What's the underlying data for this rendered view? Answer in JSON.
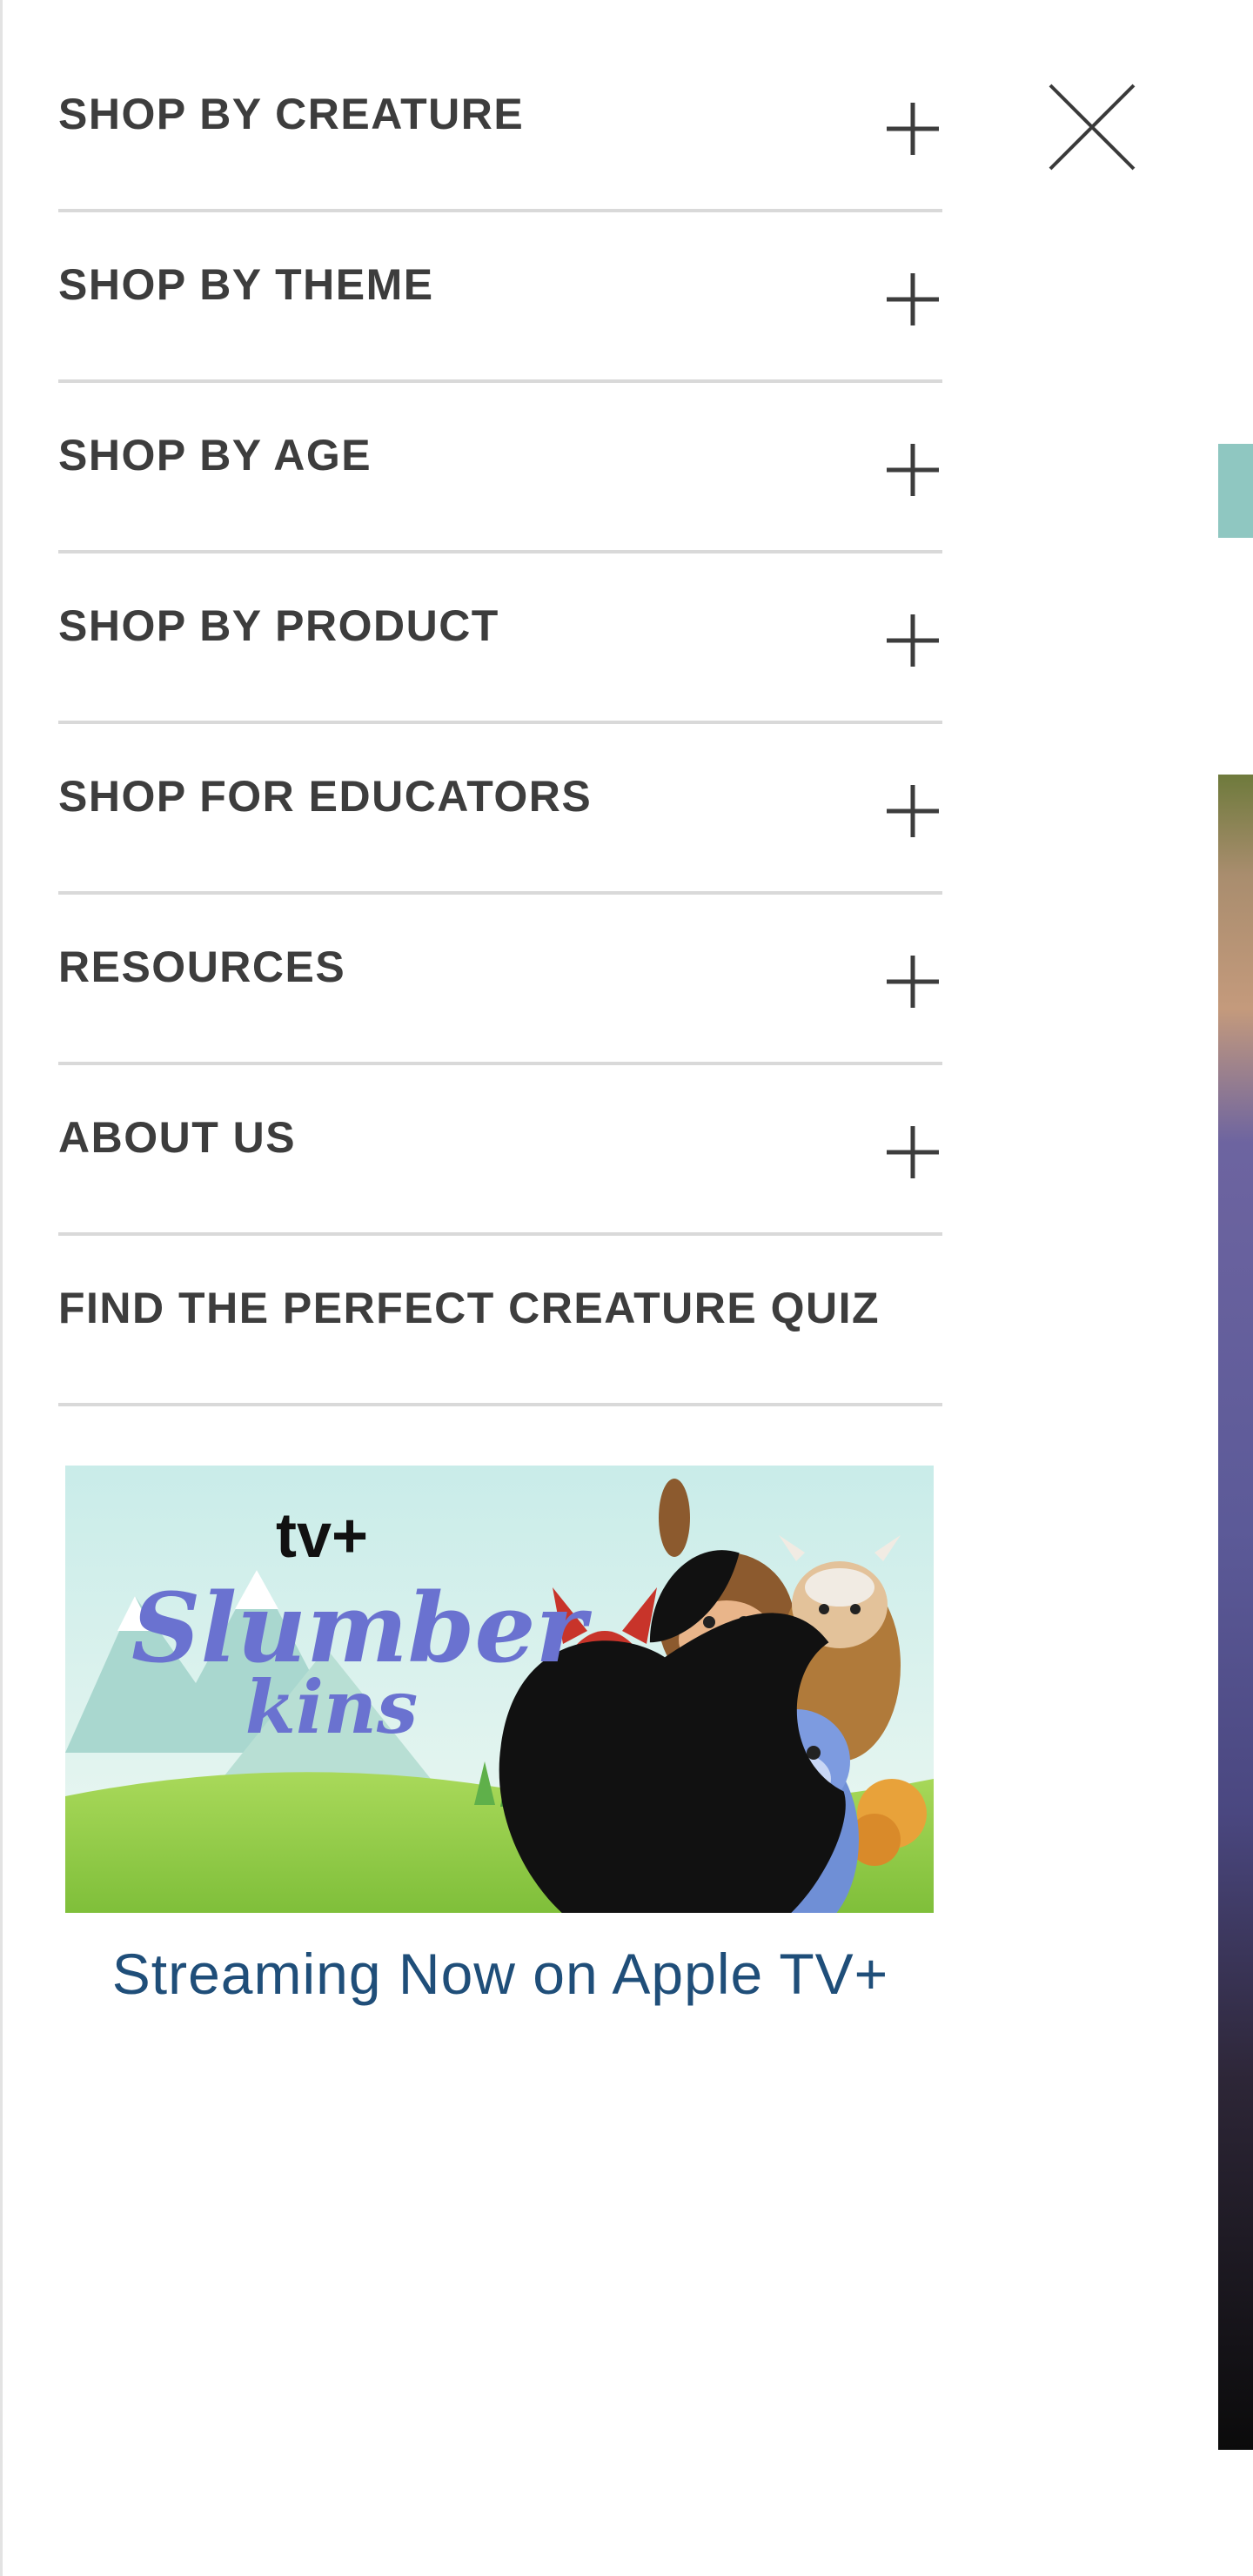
{
  "menu": {
    "items": [
      {
        "label": "SHOP BY CREATURE",
        "icon": "plus-icon"
      },
      {
        "label": "SHOP BY THEME",
        "icon": "plus-icon"
      },
      {
        "label": "SHOP BY AGE",
        "icon": "plus-icon"
      },
      {
        "label": "SHOP BY PRODUCT",
        "icon": "plus-icon"
      },
      {
        "label": "SHOP FOR EDUCATORS",
        "icon": "plus-icon"
      },
      {
        "label": "RESOURCES",
        "icon": "plus-icon"
      },
      {
        "label": "ABOUT US",
        "icon": "plus-icon"
      },
      {
        "label": "FIND THE PERFECT CREATURE QUIZ"
      }
    ],
    "close_icon": "close-icon"
  },
  "promo": {
    "platform": "tv+",
    "title_line1": "Slumber",
    "title_line2": "kins",
    "caption": "Streaming Now on Apple TV+"
  },
  "colors": {
    "menu_text": "#3d3d3d",
    "divider": "#d9d9d9",
    "caption_link": "#1f4e79",
    "title_lettering": "#6a72d0",
    "teal_accent": "#8fc7c1"
  }
}
